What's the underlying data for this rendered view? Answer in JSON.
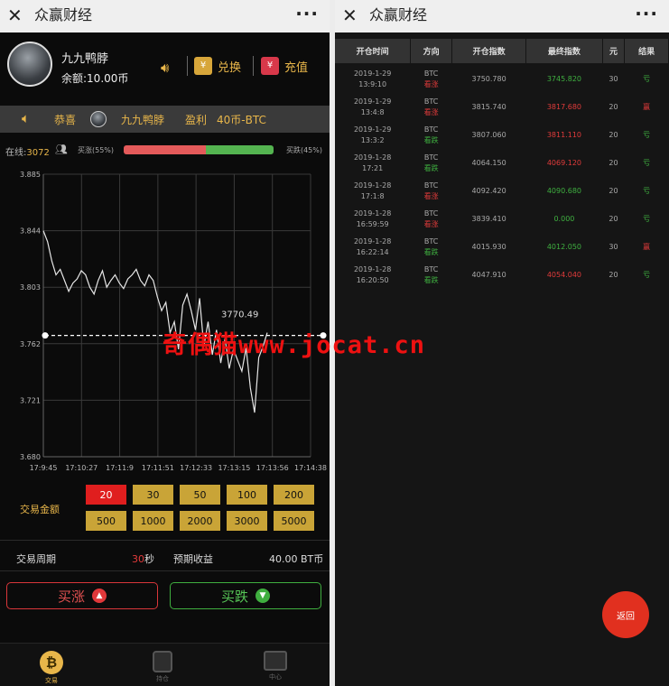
{
  "left": {
    "topbar": {
      "close_icon": "close-icon",
      "title": "众赢财经",
      "more": "···"
    },
    "user": {
      "name": "九九鸭脖",
      "balance": "余额:10.00币"
    },
    "actions": {
      "exchange": "兑换",
      "recharge": "充值"
    },
    "notice": {
      "congrats": "恭喜",
      "name": "九九鸭脖",
      "profit_label": "盈利",
      "profit_value": "40币-BTC"
    },
    "stats": {
      "online_label": "在线:",
      "online_count": "3072",
      "buy_up_pct": "买涨(55%)",
      "buy_down_pct": "买跌(45%)",
      "up_ratio": 0.55
    },
    "chart_data": {
      "type": "line",
      "ylim": [
        3.68,
        3.885
      ],
      "yticks": [
        "3.885",
        "3.844",
        "3.803",
        "3.762",
        "3.721",
        "3.680"
      ],
      "xticks": [
        "17:9:45",
        "17:10:27",
        "17:11:9",
        "17:11:51",
        "17:12:33",
        "17:13:15",
        "17:13:56",
        "17:14:38"
      ],
      "series": [
        {
          "values": [
            3.844,
            3.836,
            3.822,
            3.812,
            3.816,
            3.808,
            3.8,
            3.806,
            3.809,
            3.815,
            3.812,
            3.803,
            3.798,
            3.808,
            3.815,
            3.803,
            3.808,
            3.812,
            3.806,
            3.802,
            3.809,
            3.812,
            3.816,
            3.808,
            3.804,
            3.812,
            3.808,
            3.796,
            3.786,
            3.792,
            3.77,
            3.778,
            3.758,
            3.79,
            3.798,
            3.786,
            3.772,
            3.795,
            3.76,
            3.778,
            3.754,
            3.772,
            3.748,
            3.766,
            3.744,
            3.758,
            3.75,
            3.742,
            3.759,
            3.73,
            3.712,
            3.752,
            3.76,
            3.77
          ]
        }
      ],
      "current_value": 3.768,
      "current_label": "3770.49"
    },
    "amount_label": "交易金额",
    "amounts": [
      "20",
      "30",
      "50",
      "100",
      "200",
      "500",
      "1000",
      "2000",
      "3000",
      "5000"
    ],
    "selected_amount": "20",
    "period": {
      "label": "交易周期",
      "seconds": "30",
      "unit": "秒",
      "expected_label": "预期收益",
      "expected_value": "40.00 BT币"
    },
    "buttons": {
      "buy_up": "买涨",
      "buy_down": "买跌"
    },
    "tabs": [
      "交易",
      "持仓",
      "中心"
    ]
  },
  "right": {
    "topbar": {
      "close_icon": "close-icon",
      "title": "众赢财经",
      "more": "···"
    },
    "table": {
      "headers": [
        "开仓时间",
        "方向",
        "开仓指数",
        "最终指数",
        "元",
        "结果"
      ],
      "rows": [
        {
          "date": "2019-1-29",
          "time": "13:9:10",
          "asset": "BTC",
          "dir": "看涨",
          "dir_color": "red",
          "open": "3750.780",
          "final": "3745.820",
          "final_color": "green",
          "amount": "30",
          "result": "亏",
          "result_color": "green"
        },
        {
          "date": "2019-1-29",
          "time": "13:4:8",
          "asset": "BTC",
          "dir": "看涨",
          "dir_color": "red",
          "open": "3815.740",
          "final": "3817.680",
          "final_color": "red",
          "amount": "20",
          "result": "赢",
          "result_color": "red"
        },
        {
          "date": "2019-1-29",
          "time": "13:3:2",
          "asset": "BTC",
          "dir": "看跌",
          "dir_color": "green",
          "open": "3807.060",
          "final": "3811.110",
          "final_color": "red",
          "amount": "20",
          "result": "亏",
          "result_color": "green"
        },
        {
          "date": "2019-1-28",
          "time": "17:21",
          "asset": "BTC",
          "dir": "看跌",
          "dir_color": "green",
          "open": "4064.150",
          "final": "4069.120",
          "final_color": "red",
          "amount": "20",
          "result": "亏",
          "result_color": "green"
        },
        {
          "date": "2019-1-28",
          "time": "17:1:8",
          "asset": "BTC",
          "dir": "看涨",
          "dir_color": "red",
          "open": "4092.420",
          "final": "4090.680",
          "final_color": "green",
          "amount": "20",
          "result": "亏",
          "result_color": "green"
        },
        {
          "date": "2019-1-28",
          "time": "16:59:59",
          "asset": "BTC",
          "dir": "看涨",
          "dir_color": "red",
          "open": "3839.410",
          "final": "0.000",
          "final_color": "green",
          "amount": "20",
          "result": "亏",
          "result_color": "green"
        },
        {
          "date": "2019-1-28",
          "time": "16:22:14",
          "asset": "BTC",
          "dir": "看跌",
          "dir_color": "green",
          "open": "4015.930",
          "final": "4012.050",
          "final_color": "green",
          "amount": "30",
          "result": "赢",
          "result_color": "red"
        },
        {
          "date": "2019-1-28",
          "time": "16:20:50",
          "asset": "BTC",
          "dir": "看跌",
          "dir_color": "green",
          "open": "4047.910",
          "final": "4054.040",
          "final_color": "red",
          "amount": "20",
          "result": "亏",
          "result_color": "green"
        }
      ]
    },
    "back_button": "返回"
  },
  "watermark": {
    "cn": "奇偶猫",
    "url": "www.jocat.cn"
  },
  "colors": {
    "gold": "#e8b64a",
    "up_red": "#e23b3b",
    "down_green": "#3fb040",
    "amount_gold": "#c9a437",
    "selected_red": "#e01e1e"
  }
}
